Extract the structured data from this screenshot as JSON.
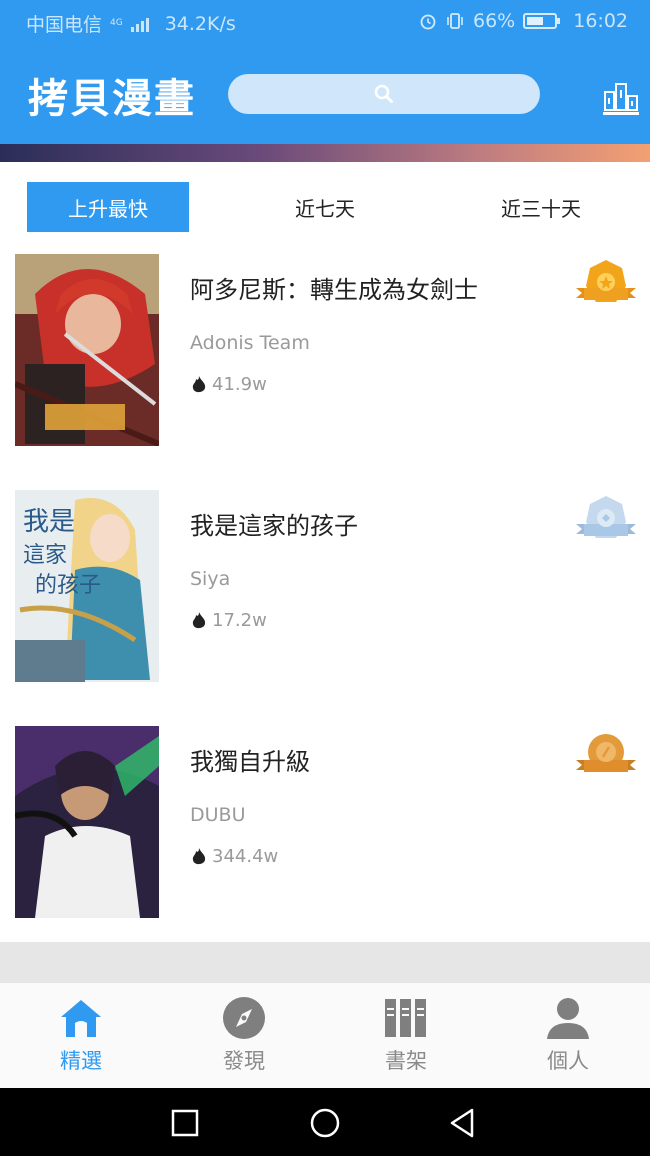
{
  "status_bar": {
    "carrier": "中国电信",
    "network_badge": "4G",
    "speed": "34.2K/s",
    "battery": "66%",
    "time": "16:02"
  },
  "header": {
    "title": "拷貝漫畫",
    "search_icon": "search-icon",
    "rank_icon": "ranking-icon"
  },
  "tabs": [
    {
      "label": "上升最快",
      "active": true
    },
    {
      "label": "近七天",
      "active": false
    },
    {
      "label": "近三十天",
      "active": false
    }
  ],
  "comics": [
    {
      "title": "阿多尼斯：轉生成為女劍士",
      "author": "Adonis Team",
      "heat": "41.9w",
      "medal": "gold"
    },
    {
      "title": "我是這家的孩子",
      "author": "Siya",
      "heat": "17.2w",
      "medal": "silver"
    },
    {
      "title": "我獨自升級",
      "author": "DUBU",
      "heat": "344.4w",
      "medal": "bronze"
    }
  ],
  "bottom_nav": [
    {
      "label": "精選",
      "icon": "home-icon",
      "active": true
    },
    {
      "label": "發現",
      "icon": "compass-icon",
      "active": false
    },
    {
      "label": "書架",
      "icon": "bookshelf-icon",
      "active": false
    },
    {
      "label": "個人",
      "icon": "person-icon",
      "active": false
    }
  ],
  "colors": {
    "primary": "#2f9af0",
    "gold": "#f2a51a",
    "silver": "#a9c7e6",
    "bronze": "#e39a3a"
  }
}
